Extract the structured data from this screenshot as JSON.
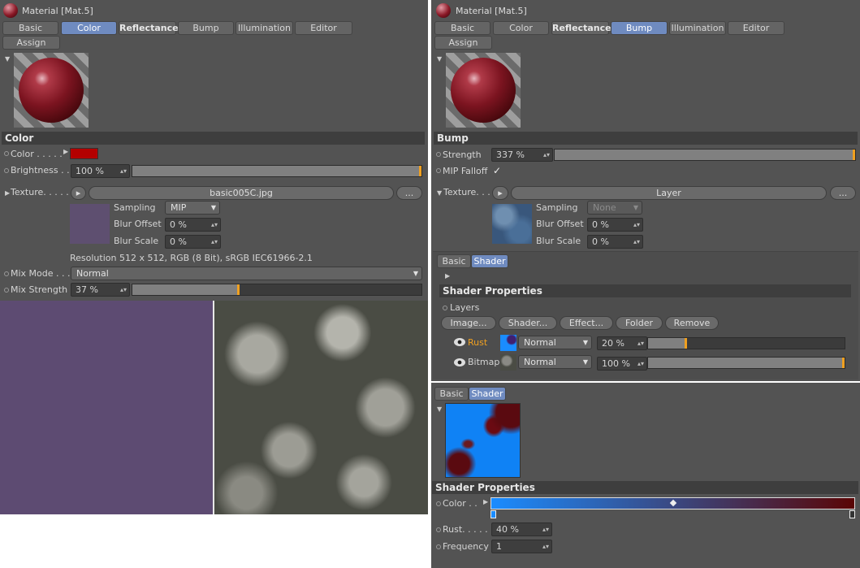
{
  "left": {
    "title": "Material [Mat.5]",
    "tabs": [
      "Basic",
      "Color",
      "Reflectance",
      "Bump",
      "Illumination",
      "Editor"
    ],
    "assign": "Assign",
    "section": "Color",
    "color_label": "Color . . . . .",
    "color_swatch": "#b30000",
    "brightness_label": "Brightness . .",
    "brightness_value": "100 %",
    "brightness_fraction": 1.0,
    "texture_label": "Texture. . . . .",
    "texture_file": "basic005C.jpg",
    "more_btn": "...",
    "sampling_label": "Sampling",
    "sampling_value": "MIP",
    "blur_offset_label": "Blur Offset",
    "blur_offset_value": "0 %",
    "blur_scale_label": "Blur Scale",
    "blur_scale_value": "0 %",
    "resolution": "Resolution 512 x 512, RGB (8 Bit), sRGB IEC61966-2.1",
    "mix_mode_label": "Mix Mode . . .",
    "mix_mode_value": "Normal",
    "mix_strength_label": "Mix Strength",
    "mix_strength_value": "37 %",
    "mix_strength_fraction": 0.37
  },
  "right": {
    "title": "Material [Mat.5]",
    "tabs": [
      "Basic",
      "Color",
      "Reflectance",
      "Bump",
      "Illumination",
      "Editor"
    ],
    "assign": "Assign",
    "section": "Bump",
    "strength_label": "Strength",
    "strength_value": "337 %",
    "strength_fraction": 1.0,
    "mip_falloff_label": "MIP Falloff",
    "mip_check": "✓",
    "texture_label": "Texture. . . .",
    "texture_value": "Layer",
    "more_btn": "...",
    "sampling_label": "Sampling",
    "sampling_value": "None",
    "blur_offset_label": "Blur Offset",
    "blur_offset_value": "0 %",
    "blur_scale_label": "Blur Scale",
    "blur_scale_value": "0 %",
    "subtabs": [
      "Basic",
      "Shader"
    ],
    "shader_props": "Shader Properties",
    "layers_label": "Layers",
    "layer_buttons": [
      "Image...",
      "Shader...",
      "Effect...",
      "Folder",
      "Remove"
    ],
    "layers": [
      {
        "name": "Rust",
        "mode": "Normal",
        "value": "20 %",
        "fraction": 0.2,
        "name_color": "#f0a020"
      },
      {
        "name": "Bitmap",
        "mode": "Normal",
        "value": "100 %",
        "fraction": 1.0,
        "name_color": "#d4d4d4"
      }
    ]
  },
  "bottom": {
    "subtabs": [
      "Basic",
      "Shader"
    ],
    "shader_props": "Shader Properties",
    "color_label": "Color . .",
    "gradient_start": "#1a8cff",
    "gradient_end": "#5a0505",
    "rust_label": "Rust. . . . .",
    "rust_value": "40 %",
    "frequency_label": "Frequency",
    "frequency_value": "1"
  }
}
